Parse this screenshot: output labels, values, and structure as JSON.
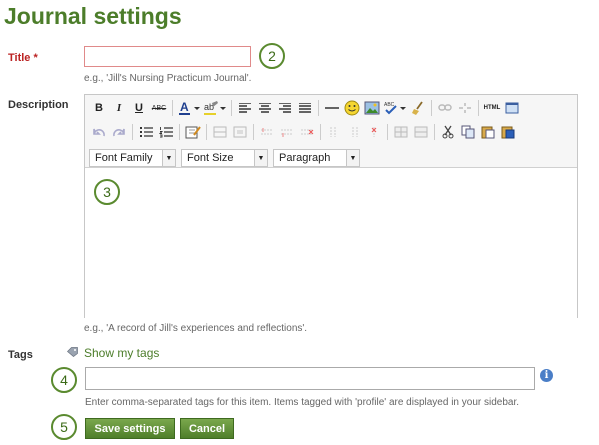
{
  "page": {
    "title": "Journal settings"
  },
  "title_field": {
    "label": "Title",
    "required_mark": "*",
    "value": "",
    "hint": "e.g., 'Jill's Nursing Practicum Journal'."
  },
  "description_field": {
    "label": "Description",
    "hint": "e.g., 'A record of Jill's experiences and reflections'.",
    "toolbar": {
      "bold": "B",
      "italic": "I",
      "underline": "U",
      "strike": "ABC",
      "font_family": "Font Family",
      "font_size": "Font Size",
      "format": "Paragraph",
      "html": "HTML"
    },
    "content": ""
  },
  "tags_field": {
    "label": "Tags",
    "show_tags_link": "Show my tags",
    "value": "",
    "hint": "Enter comma-separated tags for this item. Items tagged with 'profile' are displayed in your sidebar.",
    "info": "i"
  },
  "buttons": {
    "save": "Save settings",
    "cancel": "Cancel"
  },
  "callouts": [
    "2",
    "3",
    "4",
    "5"
  ],
  "colors": {
    "heading": "#4c7d2a",
    "required": "#b22222",
    "button": "#5e8f35"
  }
}
